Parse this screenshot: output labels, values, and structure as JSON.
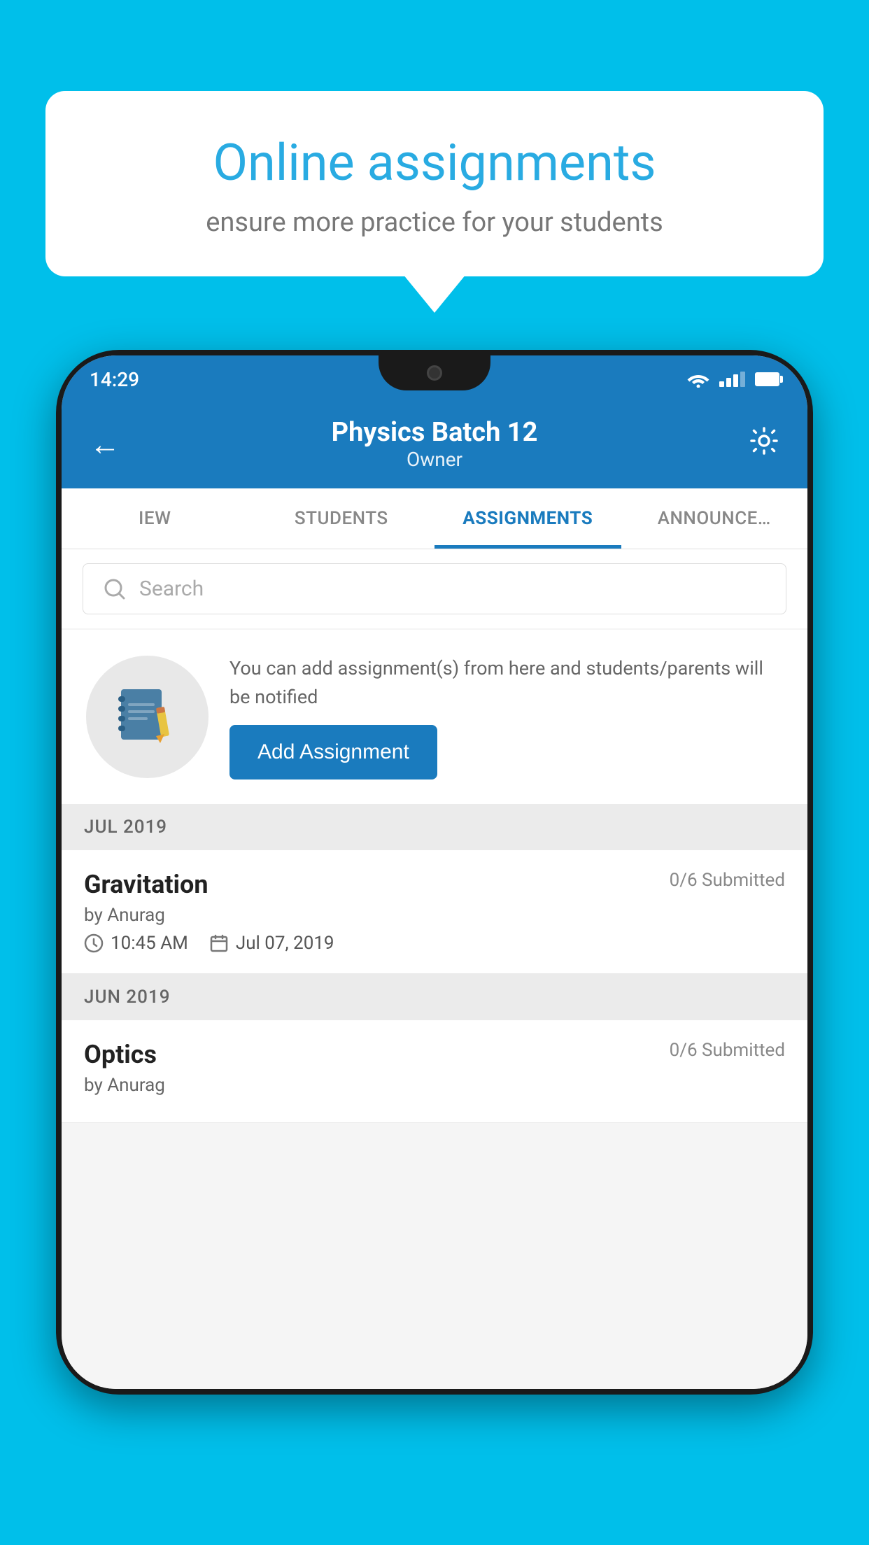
{
  "background_color": "#00BFEA",
  "speech_bubble": {
    "title": "Online assignments",
    "subtitle": "ensure more practice for your students"
  },
  "phone": {
    "status_bar": {
      "time": "14:29"
    },
    "header": {
      "title": "Physics Batch 12",
      "subtitle": "Owner"
    },
    "tabs": [
      {
        "label": "IEW",
        "active": false
      },
      {
        "label": "STUDENTS",
        "active": false
      },
      {
        "label": "ASSIGNMENTS",
        "active": true
      },
      {
        "label": "ANNOUNCEMENTS",
        "active": false
      }
    ],
    "search": {
      "placeholder": "Search"
    },
    "promo": {
      "text": "You can add assignment(s) from here and students/parents will be notified",
      "button_label": "Add Assignment"
    },
    "sections": [
      {
        "label": "JUL 2019",
        "assignments": [
          {
            "title": "Gravitation",
            "submitted": "0/6 Submitted",
            "author": "by Anurag",
            "time": "10:45 AM",
            "date": "Jul 07, 2019"
          }
        ]
      },
      {
        "label": "JUN 2019",
        "assignments": [
          {
            "title": "Optics",
            "submitted": "0/6 Submitted",
            "author": "by Anurag",
            "time": "",
            "date": ""
          }
        ]
      }
    ]
  }
}
